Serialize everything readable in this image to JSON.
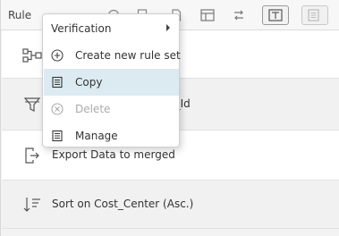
{
  "panel": {
    "title": "Rule"
  },
  "rows": [
    {
      "text": "",
      "icon": "connector-icon"
    },
    {
      "text": "n_Id",
      "icon": "filter-icon"
    },
    {
      "text": "Export Data to merged",
      "icon": "export-icon"
    },
    {
      "text": "Sort on Cost_Center (Asc.)",
      "icon": "sort-ascending-icon"
    }
  ],
  "context_menu": {
    "items": [
      {
        "label": "Verification",
        "icon": "",
        "submenu": true,
        "enabled": true
      },
      {
        "label": "Create new rule set",
        "icon": "plus-circle-icon",
        "enabled": true
      },
      {
        "label": "Copy",
        "icon": "copy-icon",
        "enabled": true,
        "highlighted": true
      },
      {
        "label": "Delete",
        "icon": "delete-circle-icon",
        "enabled": false
      },
      {
        "label": "Manage",
        "icon": "manage-list-icon",
        "enabled": true
      }
    ]
  },
  "colors": {
    "highlight": "#dcebf1",
    "disabled_text": "#aaaaaa"
  }
}
